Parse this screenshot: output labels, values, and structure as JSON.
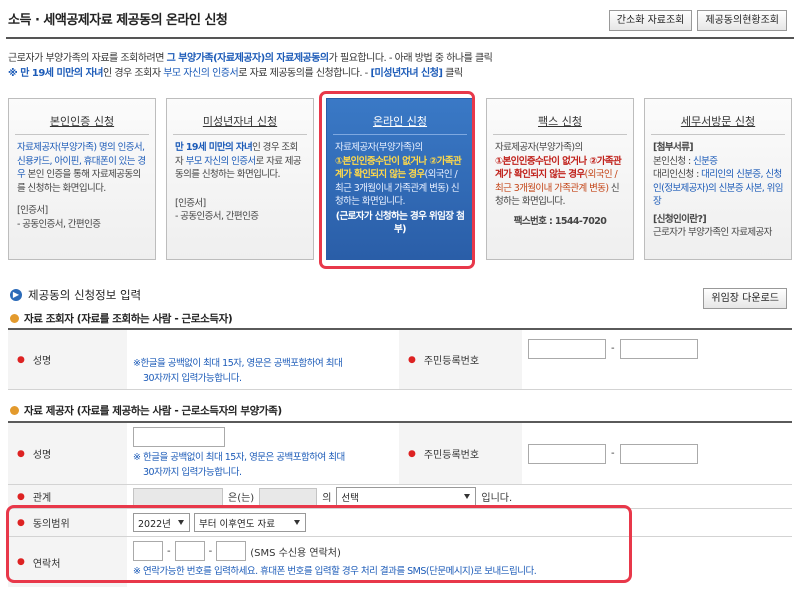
{
  "header": {
    "title": "소득 · 세액공제자료 제공동의 온라인 신청",
    "btn_simple": "간소화 자료조회",
    "btn_status": "제공동의현황조회"
  },
  "intro": {
    "l1a": "근로자가 부양가족의 자료를 조회하려면 ",
    "l1b": "그 부양가족(자료제공자)의 자료제공동의",
    "l1c": "가 필요합니다. - 아래 방법 중 하나를 클릭",
    "l2a": "※ 만 19세 미만의 자녀",
    "l2b": "인 경우 조회자 ",
    "l2c": "부모 자신의 인증서",
    "l2d": "로 자료 제공동의를 신청합니다. - ",
    "l2e": "[미성년자녀 신청]",
    "l2f": " 클릭"
  },
  "cards": [
    {
      "title": "본인인증 신청",
      "a": "자료제공자(부양가족) 명의 인증서, 신용카드, 아이핀, 휴대폰이 있는 경우",
      "b": " 본인 인증을 통해 자료제공동의를 신청하는 화면입니다.",
      "c": "[인증서]",
      "d": "- 공동인증서, 간편인증"
    },
    {
      "title": "미성년자녀 신청",
      "a": "만 19세 미만의 자녀",
      "b": "인 경우 조회자 ",
      "b2": "부모 자신의 인증서",
      "b3": "로 자료 제공 동의를 신청하는 화면입니다.",
      "c": "[인증서]",
      "d": "- 공동인증서, 간편인증"
    },
    {
      "title": "온라인 신청",
      "a": "자료제공자(부양가족)의",
      "b": "①본인인증수단이 없거나 ②가족관계가 확인되지 않는 경우",
      "b2": "(외국인 / 최근 3개월이내 가족관계 변동)",
      "b3": " 신청하는 화면입니다.",
      "c": "(근로자가 신청하는 경우 위임장 첨부)"
    },
    {
      "title": "팩스 신청",
      "a": "자료제공자(부양가족)의",
      "b": "①본인인증수단이 없거나 ②가족관계가 확인되지 않는 경우",
      "b2": "(외국인 / 최근 3개월이내 가족관계 변동)",
      "b3": " 신청하는 화면입니다.",
      "c": "팩스번호 : 1544-7020"
    },
    {
      "title": "세무서방문 신청",
      "a": "[첨부서류]",
      "b": "본인신청 : ",
      "b2": "신분증",
      "b3": "대리인신청 : ",
      "b4": "대리인의 신분증, 신청인(정보제공자)의 신분증 사본, 위임장",
      "c": "[신청인이란?]",
      "d": "근로자가 부양가족인 자료제공자"
    }
  ],
  "section": {
    "title": "제공동의 신청정보 입력",
    "proxy_btn": "위임장 다운로드"
  },
  "viewer": {
    "title": "자료 조회자 (자료를 조회하는 사람 - 근로소득자)",
    "name_label": "성명",
    "name_note1": "※한글을 공백없이 최대 15자, 영문은 공백포함하여 최대",
    "name_note2": "30자까지 입력가능합니다.",
    "rrn_label": "주민등록번호",
    "dash": "-"
  },
  "provider": {
    "title": "자료 제공자 (자료를 제공하는 사람 - 근로소득자의 부양가족)",
    "name_label": "성명",
    "name_note1": "※ 한글을 공백없이 최대 15자, 영문은 공백포함하여 최대",
    "name_note2": "30자까지 입력가능합니다.",
    "rrn_label": "주민등록번호",
    "dash": "-",
    "rel_label": "관계",
    "rel_eun": "은(는)",
    "rel_ui": "의",
    "rel_select": "선택",
    "rel_end": "입니다.",
    "range_label": "동의범위",
    "range_year": "2022년",
    "range_scope": "부터 이후연도 자료",
    "contact_label": "연락처",
    "contact_sms": "(SMS 수신용 연락처)",
    "contact_note": "※ 연락가능한 번호를 입력하세요. 휴대폰 번호를 입력할 경우 처리 결과를 SMS(단문메시지)로 보내드립니다."
  }
}
